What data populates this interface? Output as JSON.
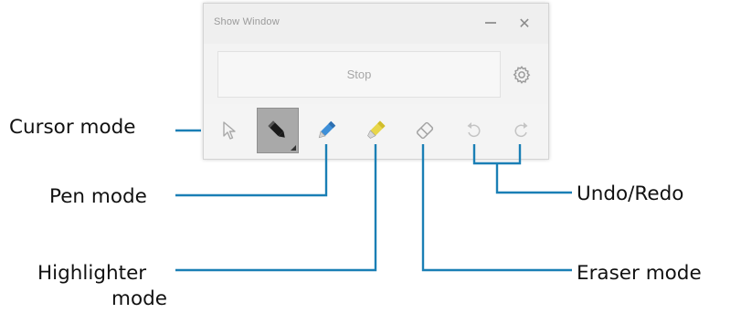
{
  "window": {
    "title": "Show Window",
    "minimize_icon": "minimize-icon",
    "close_icon": "close-icon",
    "stop_label": "Stop",
    "settings_icon": "gear-icon",
    "tools": [
      {
        "name": "cursor",
        "icon": "cursor-icon",
        "selected": false
      },
      {
        "name": "pen",
        "icon": "pen-icon",
        "selected": true
      },
      {
        "name": "marker",
        "icon": "marker-icon",
        "selected": false
      },
      {
        "name": "highlighter",
        "icon": "highlighter-icon",
        "selected": false
      },
      {
        "name": "eraser",
        "icon": "eraser-icon",
        "selected": false
      },
      {
        "name": "undo",
        "icon": "undo-icon",
        "selected": false
      },
      {
        "name": "redo",
        "icon": "redo-icon",
        "selected": false
      }
    ]
  },
  "callouts": {
    "cursor": "Cursor mode",
    "pen": "Pen mode",
    "highlighter_line1": "Highlighter",
    "highlighter_line2": "mode",
    "undo_redo": "Undo/Redo",
    "eraser": "Eraser mode"
  },
  "colors": {
    "callout_line": "#1a7fb5",
    "pen_blue": "#3e8fd8",
    "highlighter_yellow": "#e8d64a",
    "selected_tool_bg": "#a9a9a9"
  }
}
